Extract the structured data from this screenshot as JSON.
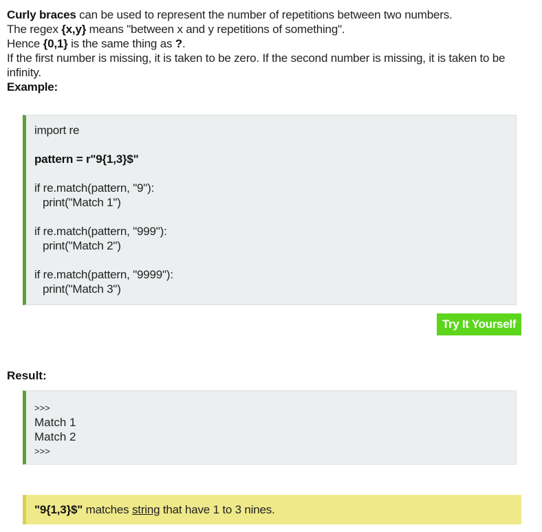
{
  "intro": {
    "line1_bold": "Curly braces",
    "line1_rest": " can be used to represent the number of repetitions between two numbers.",
    "line2_pre": "The regex ",
    "line2_bold": "{x,y}",
    "line2_rest": " means \"between x and y repetitions of something\".",
    "line3_pre": "Hence ",
    "line3_bold1": "{0,1}",
    "line3_mid": " is the same thing as ",
    "line3_bold2": "?",
    "line3_end": ".",
    "line4": "If the first number is missing, it is taken to be zero. If the second number is missing, it is taken to be infinity.",
    "example_label": "Example:"
  },
  "example": {
    "lines": [
      "import re",
      "pattern = r\"9{1,3}$\"",
      "if re.match(pattern, \"9\"):",
      "print(\"Match 1\")",
      "if re.match(pattern, \"999\"):",
      "print(\"Match 2\")",
      "if re.match(pattern, \"9999\"):",
      "print(\"Match 3\")"
    ]
  },
  "try_button": {
    "label": "Try It Yourself"
  },
  "result": {
    "label": "Result:",
    "prompt_start": ">>>",
    "output": [
      "Match 1",
      "Match 2"
    ],
    "prompt_end": ">>>"
  },
  "note": {
    "bold": "\"9{1,3}$\"",
    "pre": " matches ",
    "link": "string",
    "post": " that have 1 to 3 nines."
  },
  "colors": {
    "code_border": "#5aa03a",
    "code_bg": "#eceff0",
    "button_bg": "#5cd61b",
    "note_bg": "#f0e98a",
    "note_border": "#d9cf52"
  }
}
